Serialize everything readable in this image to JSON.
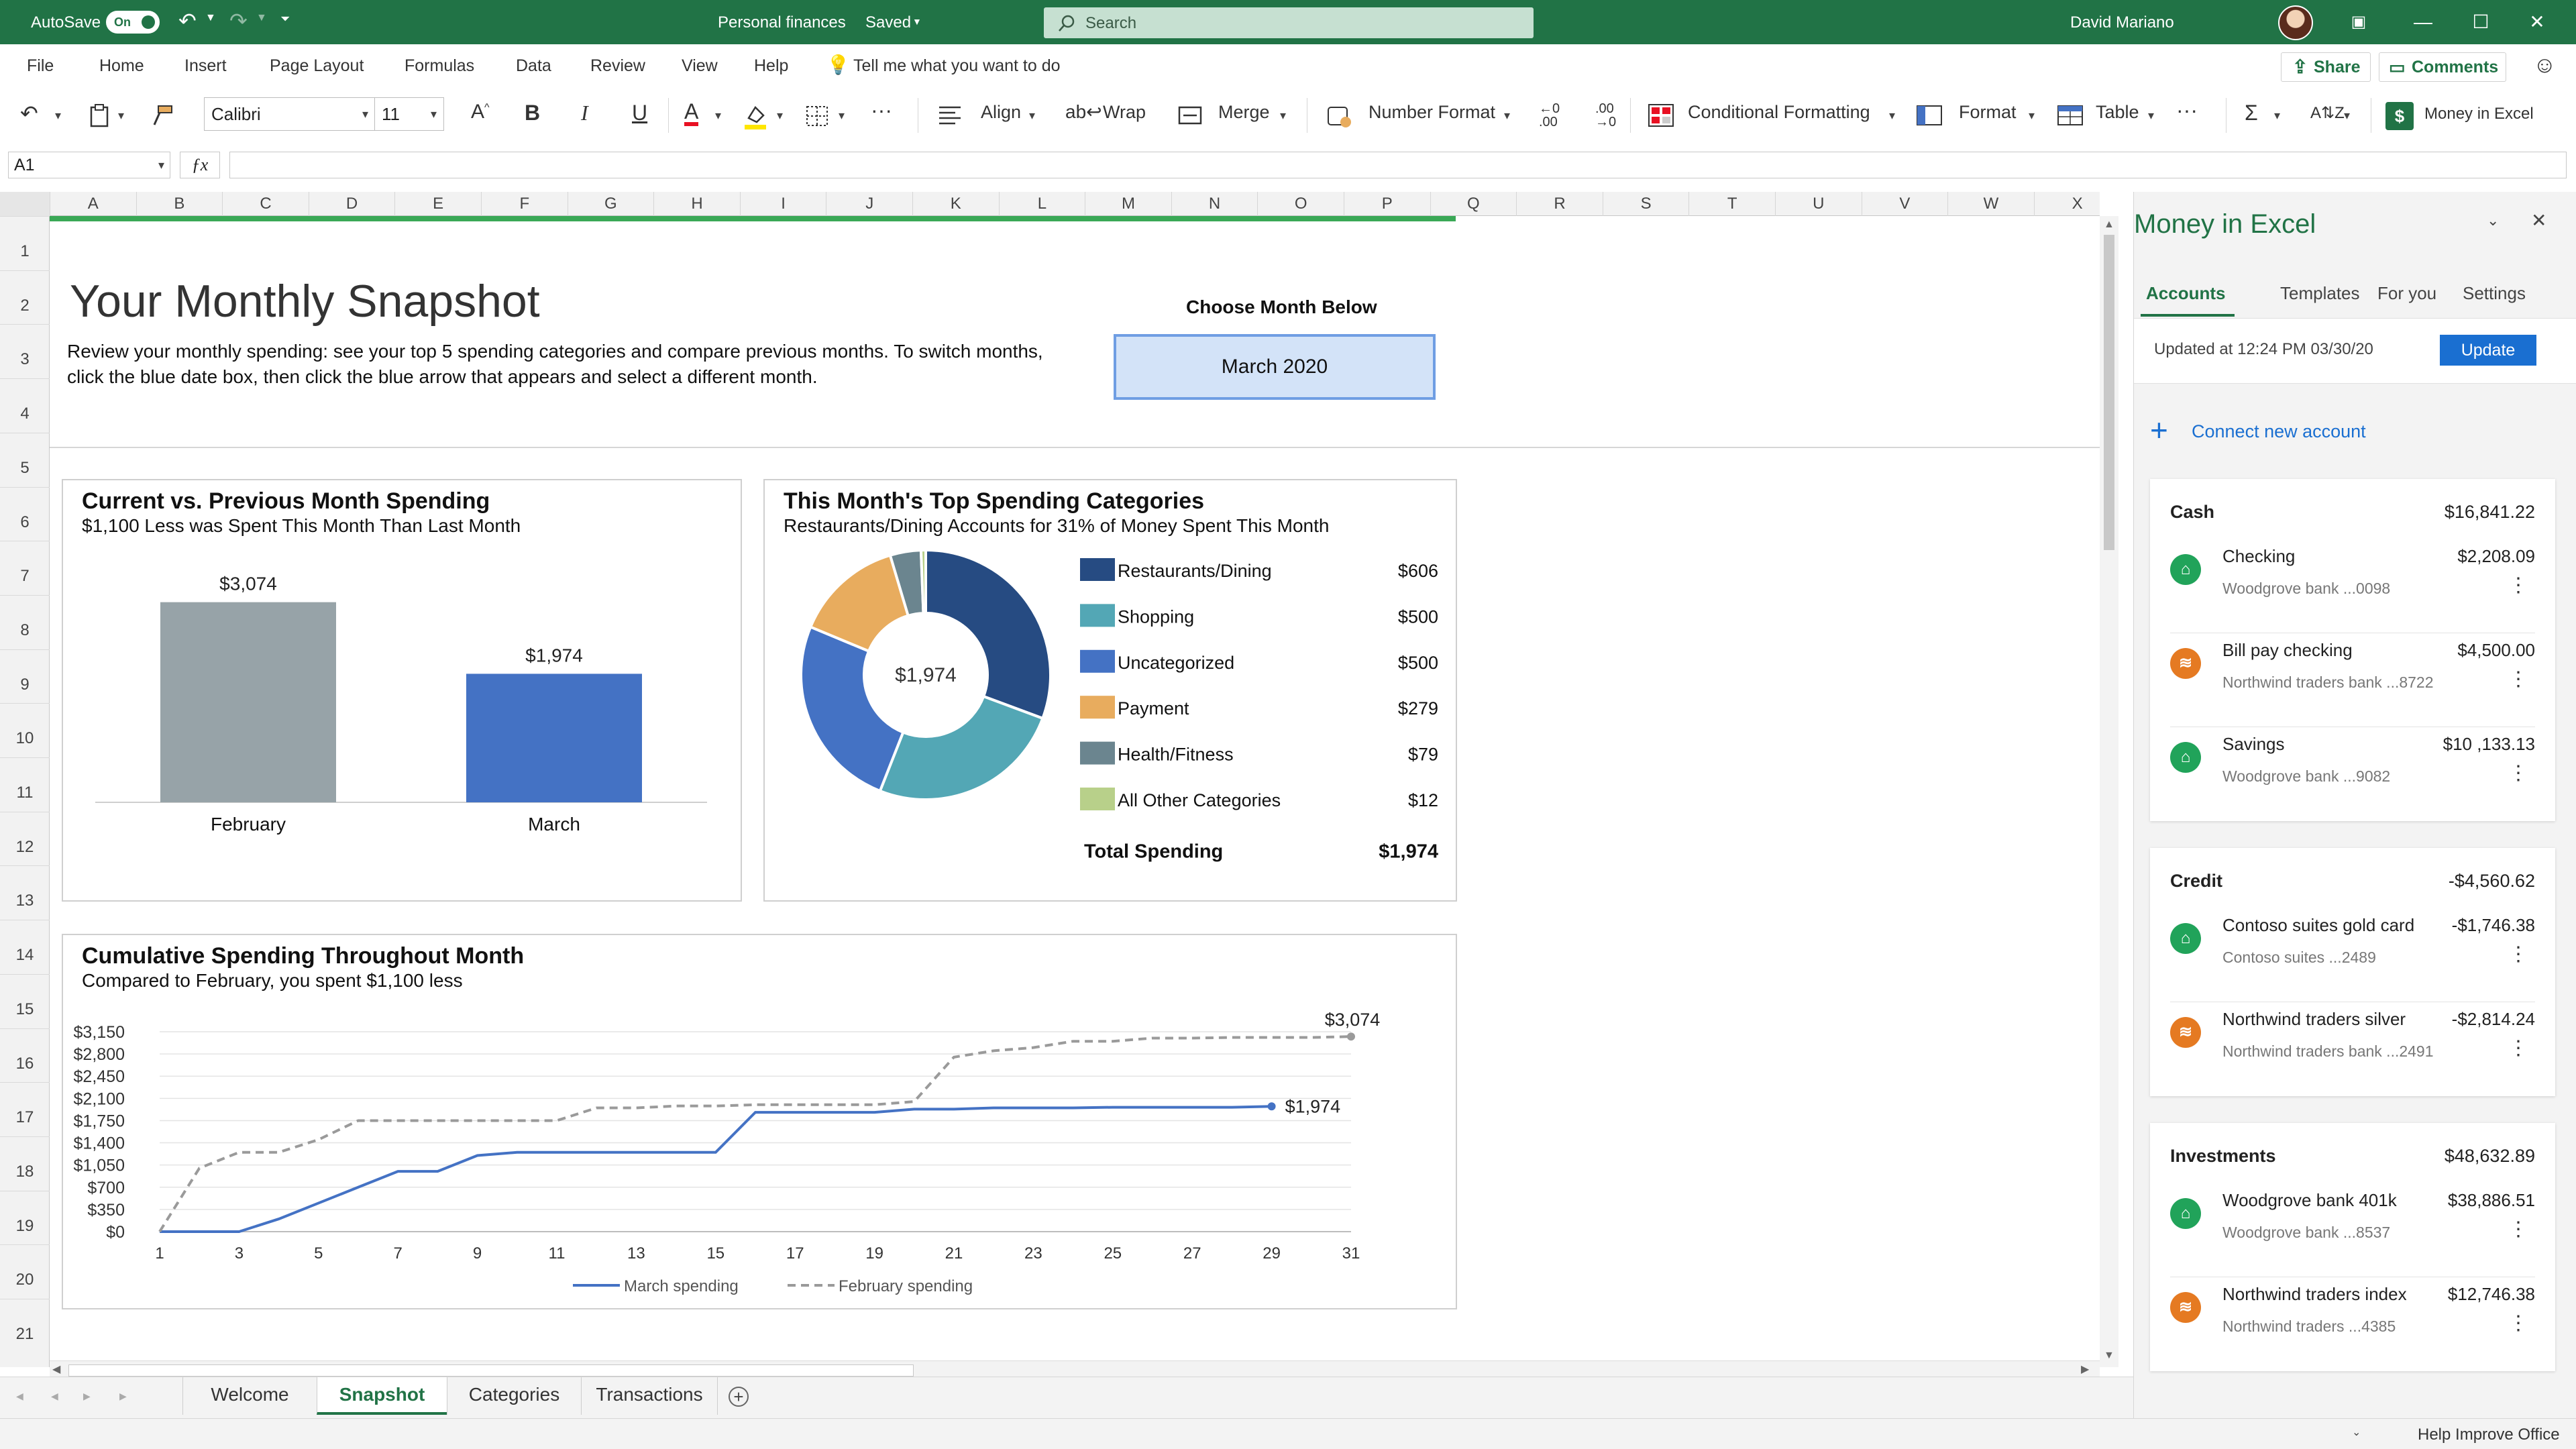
{
  "titlebar": {
    "autosave_label": "AutoSave",
    "autosave_state": "On",
    "doc_title": "Personal finances",
    "doc_status": "Saved",
    "search_placeholder": "Search",
    "user_name": "David Mariano"
  },
  "menu": {
    "items": [
      "File",
      "Home",
      "Insert",
      "Page Layout",
      "Formulas",
      "Data",
      "Review",
      "View",
      "Help"
    ],
    "tell_me": "Tell me what you want to do",
    "share_label": "Share",
    "comments_label": "Comments"
  },
  "ribbon": {
    "font_name": "Calibri",
    "font_size": "11",
    "align_label": "Align",
    "wrap_label": "Wrap",
    "merge_label": "Merge",
    "number_format_label": "Number Format",
    "conditional_formatting_label": "Conditional Formatting",
    "format_label": "Format",
    "table_label": "Table",
    "money_in_excel_label": "Money in Excel"
  },
  "formula_bar": {
    "name_box": "A1",
    "formula": ""
  },
  "grid": {
    "columns": [
      "A",
      "B",
      "C",
      "D",
      "E",
      "F",
      "G",
      "H",
      "I",
      "J",
      "K",
      "L",
      "M",
      "N",
      "O",
      "P",
      "Q",
      "R",
      "S",
      "T",
      "U",
      "V",
      "W",
      "X"
    ],
    "rows": [
      "1",
      "2",
      "3",
      "4",
      "5",
      "6",
      "7",
      "8",
      "9",
      "10",
      "11",
      "12",
      "13",
      "14",
      "15",
      "16",
      "17",
      "18",
      "19",
      "20",
      "21"
    ]
  },
  "sheet": {
    "heading": "Your Monthly Snapshot",
    "intro_line1": "Review your monthly spending: see your top 5 spending categories and compare previous months. To switch months,",
    "intro_line2": "click the blue date box, then click the blue arrow that appears and select a different month.",
    "choose_month_label": "Choose Month Below",
    "selected_month": "March 2020"
  },
  "chart_data": [
    {
      "type": "bar",
      "title": "Current vs. Previous Month Spending",
      "subtitle": "$1,100 Less was Spent This Month Than Last Month",
      "categories": [
        "February",
        "March"
      ],
      "values": [
        3074,
        1974
      ],
      "data_labels": [
        "$3,074",
        "$1,974"
      ],
      "colors": [
        "#97a3a8",
        "#4472c4"
      ],
      "ylim": [
        0,
        3400
      ]
    },
    {
      "type": "pie",
      "title": "This Month's Top Spending Categories",
      "subtitle": "Restaurants/Dining Accounts for 31% of Money Spent This Month",
      "center_label": "$1,974",
      "categories": [
        "Restaurants/Dining",
        "Shopping",
        "Uncategorized",
        "Payment",
        "Health/Fitness",
        "All Other Categories"
      ],
      "values": [
        606,
        500,
        500,
        279,
        79,
        12
      ],
      "value_labels": [
        "$606",
        "$500",
        "$500",
        "$279",
        "$79",
        "$12"
      ],
      "colors": [
        "#264b82",
        "#53a7b5",
        "#4472c4",
        "#e8ac5e",
        "#6b858f",
        "#b8d08a"
      ],
      "total_label": "Total Spending",
      "total_value": "$1,974"
    },
    {
      "type": "line",
      "title": "Cumulative Spending Throughout Month",
      "subtitle": "Compared to February, you spent $1,100 less",
      "x_ticks": [
        "1",
        "3",
        "5",
        "7",
        "9",
        "11",
        "13",
        "15",
        "17",
        "19",
        "21",
        "23",
        "25",
        "27",
        "29",
        "31"
      ],
      "y_ticks": [
        "$0",
        "$350",
        "$700",
        "$1,050",
        "$1,400",
        "$1,750",
        "$2,100",
        "$2,450",
        "$2,800",
        "$3,150"
      ],
      "ylim": [
        0,
        3150
      ],
      "xlim": [
        1,
        31
      ],
      "series": [
        {
          "name": "March spending",
          "color": "#4472c4",
          "dashed": false,
          "end_label": "$1,974",
          "x": [
            1,
            2,
            3,
            4,
            5,
            6,
            7,
            8,
            9,
            10,
            11,
            12,
            13,
            14,
            15,
            16,
            17,
            18,
            19,
            20,
            21,
            22,
            23,
            24,
            25,
            26,
            27,
            28,
            29
          ],
          "y": [
            0,
            0,
            0,
            200,
            450,
            700,
            950,
            950,
            1200,
            1250,
            1250,
            1250,
            1250,
            1250,
            1250,
            1880,
            1880,
            1880,
            1880,
            1930,
            1930,
            1950,
            1950,
            1950,
            1960,
            1960,
            1960,
            1960,
            1974
          ]
        },
        {
          "name": "February spending",
          "color": "#9a9a9a",
          "dashed": true,
          "end_label": "$3,074",
          "x": [
            1,
            2,
            3,
            4,
            5,
            6,
            7,
            8,
            9,
            10,
            11,
            12,
            13,
            14,
            15,
            16,
            17,
            18,
            19,
            20,
            21,
            22,
            23,
            24,
            25,
            26,
            27,
            28,
            29,
            30,
            31
          ],
          "y": [
            0,
            1000,
            1250,
            1250,
            1450,
            1750,
            1750,
            1750,
            1750,
            1750,
            1750,
            1950,
            1950,
            1980,
            1980,
            2000,
            2000,
            2000,
            2000,
            2050,
            2750,
            2850,
            2900,
            3000,
            3000,
            3050,
            3050,
            3060,
            3060,
            3060,
            3074
          ]
        }
      ]
    }
  ],
  "sheet_tabs": {
    "tabs": [
      "Welcome",
      "Snapshot",
      "Categories",
      "Transactions"
    ],
    "active": "Snapshot"
  },
  "status": {
    "help_improve": "Help Improve Office"
  },
  "pane": {
    "title": "Money in Excel",
    "tabs": [
      "Accounts",
      "Templates",
      "For you",
      "Settings"
    ],
    "updated_text": "Updated at 12:24 PM 03/30/20",
    "update_button": "Update",
    "connect_label": "Connect new account",
    "groups": [
      {
        "name": "Cash",
        "total": "$16,841.22",
        "accounts": [
          {
            "name": "Checking",
            "amount": "$2,208.09",
            "sub": "Woodgrove bank ...0098",
            "icon": "bank-icon",
            "color": "#21a35a"
          },
          {
            "name": "Bill pay checking",
            "amount": "$4,500.00",
            "sub": "Northwind traders bank ...8722",
            "icon": "wind-icon",
            "color": "#e57a22"
          },
          {
            "name": "Savings",
            "amount": "$10 ,133.13",
            "sub": "Woodgrove bank ...9082",
            "icon": "bank-icon",
            "color": "#21a35a"
          }
        ]
      },
      {
        "name": "Credit",
        "total": "-$4,560.62",
        "accounts": [
          {
            "name": "Contoso suites gold card",
            "amount": "-$1,746.38",
            "sub": "Contoso suites ...2489",
            "icon": "bank-icon",
            "color": "#21a35a"
          },
          {
            "name": "Northwind traders silver",
            "amount": "-$2,814.24",
            "sub": "Northwind traders bank ...2491",
            "icon": "wind-icon",
            "color": "#e57a22"
          }
        ]
      },
      {
        "name": "Investments",
        "total": "$48,632.89",
        "accounts": [
          {
            "name": "Woodgrove bank 401k",
            "amount": "$38,886.51",
            "sub": "Woodgrove bank ...8537",
            "icon": "bank-icon",
            "color": "#21a35a"
          },
          {
            "name": "Northwind traders index",
            "amount": "$12,746.38",
            "sub": "Northwind traders ...4385",
            "icon": "wind-icon",
            "color": "#e57a22"
          }
        ]
      }
    ]
  }
}
